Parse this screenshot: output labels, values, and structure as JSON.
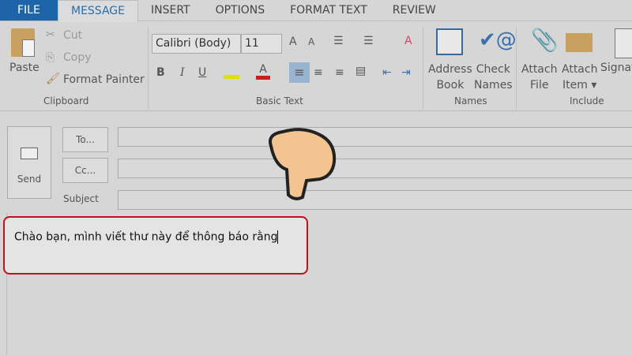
{
  "tabs": [
    "FILE",
    "MESSAGE",
    "INSERT",
    "OPTIONS",
    "FORMAT TEXT",
    "REVIEW"
  ],
  "clipboard": {
    "paste": "Paste",
    "cut": "Cut",
    "copy": "Copy",
    "format_painter": "Format Painter",
    "label": "Clipboard"
  },
  "basic_text": {
    "font": "Calibri (Body)",
    "size": "11",
    "bold": "B",
    "italic": "I",
    "underline": "U",
    "label": "Basic Text"
  },
  "names": {
    "address": "Address",
    "book": "Book",
    "check": "Check",
    "names_l": "Names",
    "label": "Names"
  },
  "include": {
    "attach": "Attach",
    "file": "File",
    "attach2": "Attach",
    "item": "Item",
    "signature": "Signat",
    "label": "Include"
  },
  "compose": {
    "send": "Send",
    "to": "To...",
    "cc": "Cc...",
    "subject": "Subject",
    "body": "Chào bạn, mình viết  thư này để thông báo rằng"
  },
  "colors": {
    "highlight": "#e0e000",
    "font_color": "#c81e1e",
    "file_tab": "#1e64a8",
    "annotation": "#c0121c"
  }
}
